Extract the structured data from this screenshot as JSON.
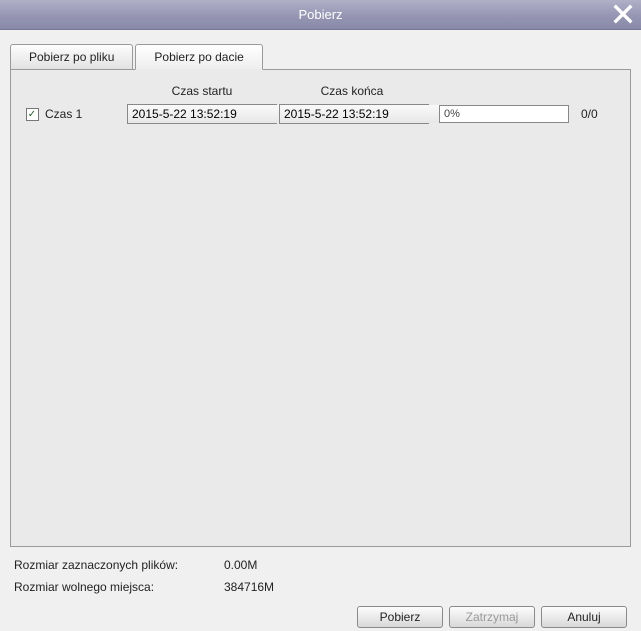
{
  "window": {
    "title": "Pobierz"
  },
  "tabs": {
    "file": "Pobierz po pliku",
    "date": "Pobierz po dacie"
  },
  "headers": {
    "start": "Czas startu",
    "end": "Czas końca"
  },
  "row": {
    "label": "Czas 1",
    "checked": true,
    "start_value": "2015-5-22 13:52:19",
    "end_value": "2015-5-22 13:52:19",
    "progress_text": "0%",
    "count_text": "0/0"
  },
  "footer": {
    "selected_label": "Rozmiar zaznaczonych plików:",
    "selected_value": "0.00M",
    "free_label": "Rozmiar wolnego miejsca:",
    "free_value": "384716M"
  },
  "buttons": {
    "download": "Pobierz",
    "stop": "Zatrzymaj",
    "cancel": "Anuluj"
  }
}
